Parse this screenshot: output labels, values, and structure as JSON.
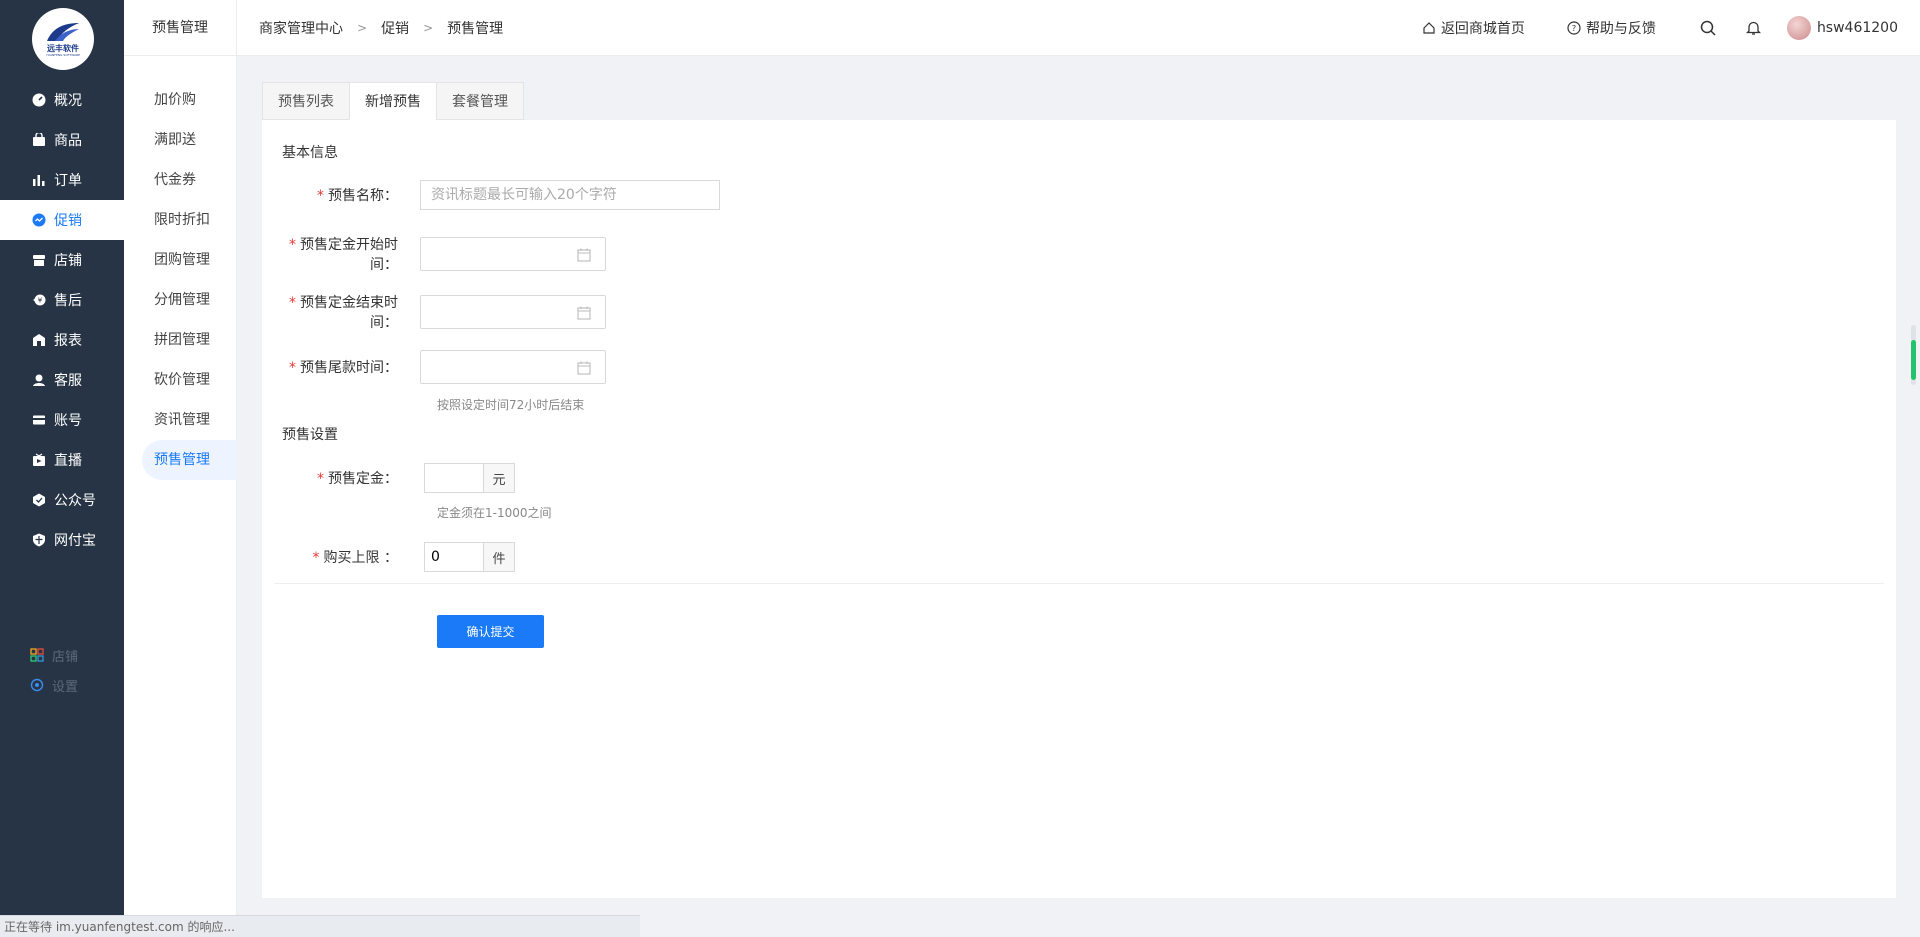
{
  "logo": {
    "text": "远丰软件",
    "sub": "YUANFENG SOFTWARE"
  },
  "sidebar": {
    "items": [
      {
        "label": "概况",
        "icon": "dashboard-icon"
      },
      {
        "label": "商品",
        "icon": "bag-icon"
      },
      {
        "label": "订单",
        "icon": "bar-chart-icon"
      },
      {
        "label": "促销",
        "icon": "promo-icon",
        "active": true
      },
      {
        "label": "店铺",
        "icon": "store-icon"
      },
      {
        "label": "售后",
        "icon": "service-icon"
      },
      {
        "label": "报表",
        "icon": "report-icon"
      },
      {
        "label": "客服",
        "icon": "headset-icon"
      },
      {
        "label": "账号",
        "icon": "card-icon"
      },
      {
        "label": "直播",
        "icon": "live-icon"
      },
      {
        "label": "公众号",
        "icon": "badge-icon"
      },
      {
        "label": "网付宝",
        "icon": "shield-icon"
      }
    ],
    "bottom": [
      {
        "label": "店铺",
        "icon": "grid-icon"
      },
      {
        "label": "设置",
        "icon": "settings-icon"
      }
    ]
  },
  "subside": {
    "title": "预售管理",
    "items": [
      "加价购",
      "满即送",
      "代金券",
      "限时折扣",
      "团购管理",
      "分佣管理",
      "拼团管理",
      "砍价管理",
      "资讯管理",
      "预售管理"
    ]
  },
  "topbar": {
    "crumbs": [
      "商家管理中心",
      "促销",
      "预售管理"
    ],
    "home_link": "返回商城首页",
    "help_link": "帮助与反馈",
    "username": "hsw461200"
  },
  "tabs": [
    "预售列表",
    "新增预售",
    "套餐管理"
  ],
  "form": {
    "basic_title": "基本信息",
    "name_label": "预售名称：",
    "name_placeholder": "资讯标题最长可输入20个字符",
    "deposit_start_label": "预售定金开始时间：",
    "deposit_end_label": "预售定金结束时间：",
    "final_time_label": "预售尾款时间：",
    "final_time_hint": "按照设定时间72小时后结束",
    "settings_title": "预售设置",
    "deposit_label": "预售定金：",
    "deposit_unit": "元",
    "deposit_hint": "定金须在1-1000之间",
    "limit_label": "购买上限 ：",
    "limit_value": "0",
    "limit_unit": "件",
    "submit_label": "确认提交"
  },
  "status": {
    "text": "正在等待 im.yuanfengtest.com 的响应..."
  },
  "colors": {
    "accent": "#1a7af8",
    "sidebar_bg": "#263445",
    "required": "#e53935"
  }
}
